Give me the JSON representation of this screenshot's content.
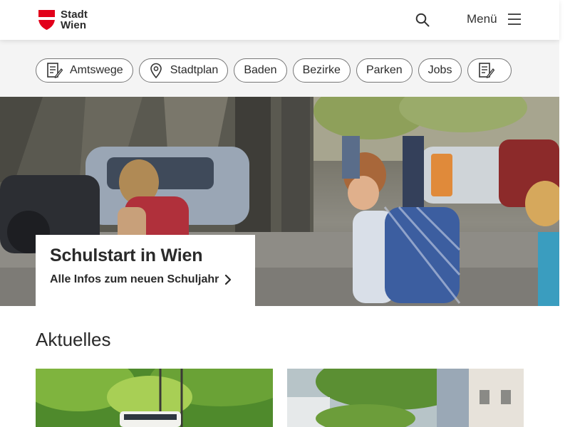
{
  "header": {
    "logo_line1": "Stadt",
    "logo_line2": "Wien",
    "menu_label": "Menü"
  },
  "quicklinks": [
    {
      "label": "Amtswege",
      "icon": "form-icon"
    },
    {
      "label": "Stadtplan",
      "icon": "location-pin-icon"
    },
    {
      "label": "Baden",
      "icon": ""
    },
    {
      "label": "Bezirke",
      "icon": ""
    },
    {
      "label": "Parken",
      "icon": ""
    },
    {
      "label": "Jobs",
      "icon": ""
    },
    {
      "label": "",
      "icon": "form-icon"
    }
  ],
  "hero": {
    "title": "Schulstart in Wien",
    "link": "Alle Infos zum neuen Schuljahr"
  },
  "news": {
    "section_title": "Aktuelles"
  },
  "colors": {
    "brand_red": "#e2001a",
    "text": "#2a2a2a"
  }
}
